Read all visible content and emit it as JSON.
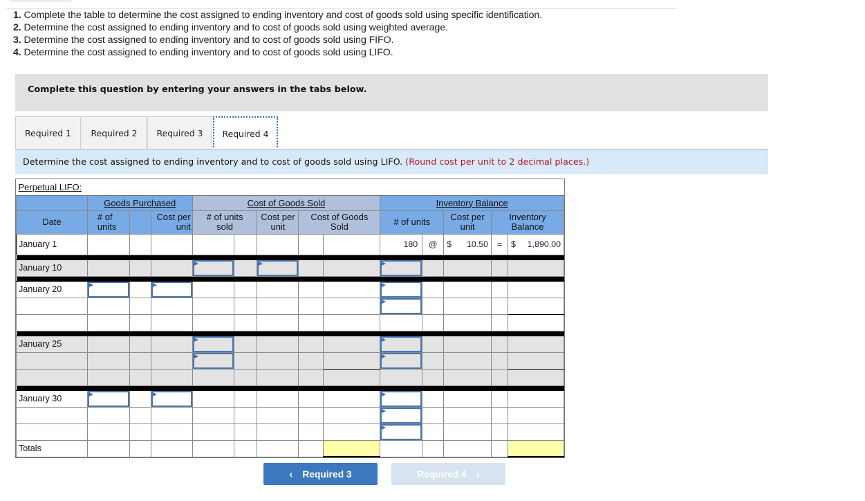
{
  "questions": [
    {
      "num": "1.",
      "text": "Complete the table to determine the cost assigned to ending inventory and cost of goods sold using specific identification."
    },
    {
      "num": "2.",
      "text": "Determine the cost assigned to ending inventory and to cost of goods sold using weighted average."
    },
    {
      "num": "3.",
      "text": "Determine the cost assigned to ending inventory and to cost of goods sold using FIFO."
    },
    {
      "num": "4.",
      "text": "Determine the cost assigned to ending inventory and to cost of goods sold using LIFO."
    }
  ],
  "instruction_box": "Complete this question by entering your answers in the tabs below.",
  "tabs": [
    {
      "label": "Required 1",
      "active": false
    },
    {
      "label": "Required 2",
      "active": false
    },
    {
      "label": "Required 3",
      "active": false
    },
    {
      "label": "Required 4",
      "active": true
    }
  ],
  "sub_instruction": {
    "text": "Determine the cost assigned to ending inventory and to cost of goods sold using LIFO.",
    "note": "(Round cost per unit to 2 decimal places.)",
    "note_color": "#b3162a"
  },
  "table": {
    "title": "Perpetual LIFO:",
    "groups": {
      "goods_purchased": "Goods Purchased",
      "cogs": "Cost of Goods Sold",
      "inventory_balance": "Inventory Balance"
    },
    "headers": {
      "date": "Date",
      "gp_units": "# of\nunits",
      "gp_cost": "Cost per\nunit",
      "cogs_units": "# of units\nsold",
      "cogs_cost": "Cost per\nunit",
      "cogs_total": "Cost of Goods\nSold",
      "ib_units": "# of units",
      "ib_cost": "Cost per\nunit",
      "ib_balance": "Inventory\nBalance"
    },
    "rows": {
      "jan1": {
        "date": "January 1",
        "ib_units": "180",
        "at": "@",
        "currency": "$",
        "ib_cost": "10.50",
        "eq": "=",
        "ib_balance": "1,890.00"
      },
      "jan10": {
        "date": "January 10"
      },
      "jan20": {
        "date": "January 20"
      },
      "jan25": {
        "date": "January 25"
      },
      "jan30": {
        "date": "January 30"
      },
      "totals": {
        "date": "Totals"
      }
    }
  },
  "nav": {
    "prev_label": "Required 3",
    "next_label": "Required 4",
    "prev_icon": "chevron-left-icon",
    "next_icon": "chevron-right-icon"
  },
  "colors": {
    "header_blue": "#78aae6",
    "header_gray_blue": "#b0c0dc",
    "subinstr_bg": "#d8e9f7",
    "input_border": "#4a78ad",
    "nav_primary": "#3b78be",
    "nav_disabled": "#d7e3f1",
    "total_yellow": "#ffffa8"
  }
}
